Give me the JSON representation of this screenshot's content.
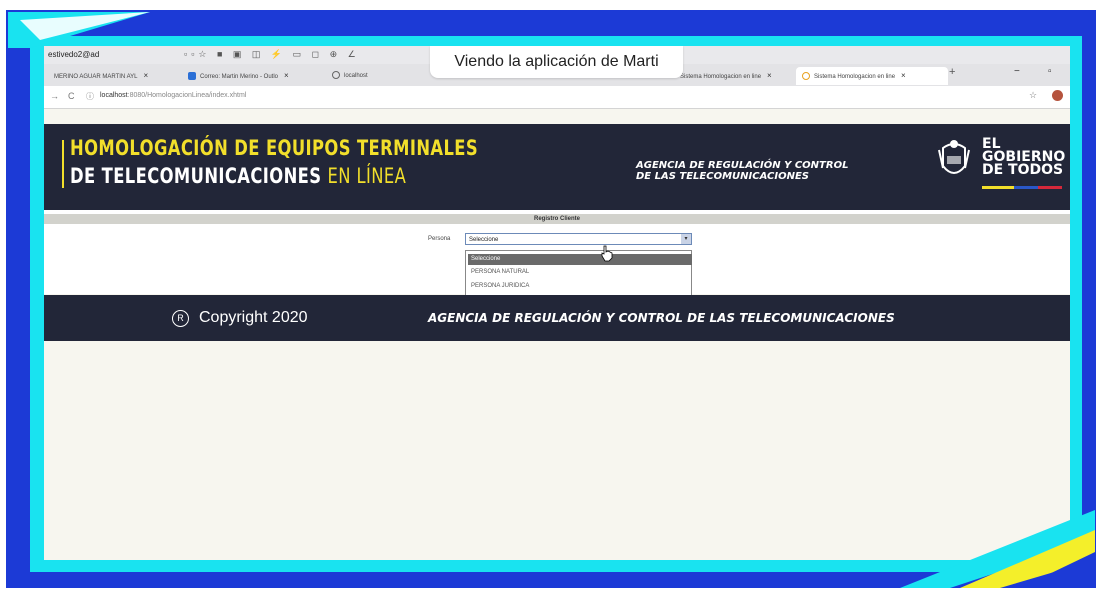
{
  "browser": {
    "profile": "estivedo2@ad",
    "tabs": [
      {
        "label": "MERINO AGUAR MARTIN AYL",
        "active": false
      },
      {
        "label": "Correo: Martin Merino - Outlo",
        "active": false
      },
      {
        "label": "localhost",
        "active": false
      },
      {
        "label": "Sistema Homologacion en line",
        "active": false
      },
      {
        "label": "Sistema Homologacion en line",
        "active": true
      }
    ],
    "url_host": "localhost",
    "url_path": ":8080/HomologacionLinea/index.xhtml"
  },
  "screen_share": {
    "banner": "Viendo la aplicación de Marti"
  },
  "header": {
    "title_line1": "HOMOLOGACIÓN DE EQUIPOS TERMINALES",
    "title_line2_main": "DE TELECOMUNICACIONES",
    "title_line2_accent": "EN LÍNEA",
    "agency_line1": "AGENCIA DE REGULACIÓN Y CONTROL",
    "agency_line2": "DE LAS TELECOMUNICACIONES",
    "gov_line1": "EL",
    "gov_line2": "GOBIERNO",
    "gov_line3": "DE TODOS"
  },
  "form": {
    "section_title": "Registro Cliente",
    "persona_label": "Persona",
    "select_value": "Seleccione",
    "options": [
      "Seleccione",
      "PERSONA NATURAL",
      "PERSONA JURIDICA"
    ]
  },
  "footer": {
    "copyright_symbol": "R",
    "copyright": "Copyright 2020",
    "agency": "AGENCIA DE REGULACIÓN Y CONTROL DE LAS TELECOMUNICACIONES"
  },
  "colors": {
    "frame_blue": "#1c3ad6",
    "frame_cyan": "#19e3f0",
    "header_bg": "#222638",
    "accent_yellow": "#f2df2b"
  }
}
